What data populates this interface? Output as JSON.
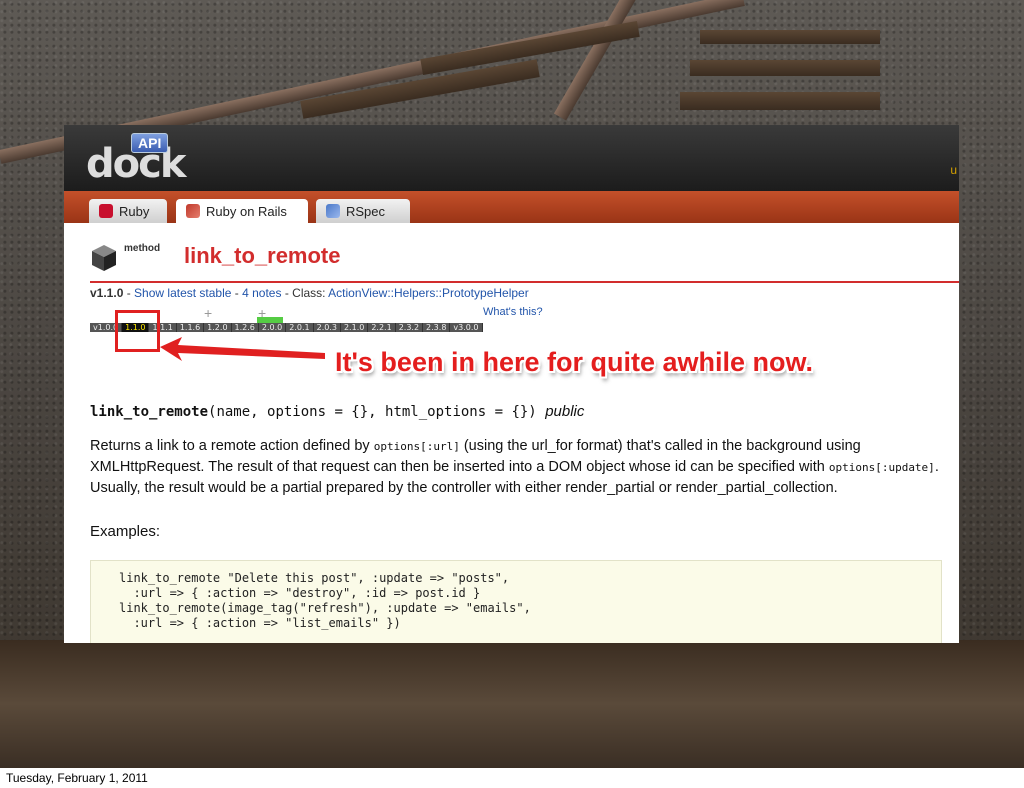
{
  "logo": {
    "api": "API",
    "name": "dock"
  },
  "header": {
    "right_glyph": "u"
  },
  "tabs": [
    {
      "label": "Ruby"
    },
    {
      "label": "Ruby on Rails"
    },
    {
      "label": "RSpec"
    }
  ],
  "method": {
    "kind": "method",
    "title": "link_to_remote",
    "version": "v1.1.0",
    "show_latest": "Show latest stable",
    "notes": "4 notes",
    "class_label": "Class:",
    "class_path": "ActionView::Helpers::PrototypeHelper",
    "whats_this": "What's this?"
  },
  "versions": [
    "v1.0.0",
    "1.1.0",
    "1.1.1",
    "1.1.6",
    "1.2.0",
    "1.2.6",
    "2.0.0",
    "2.0.1",
    "2.0.3",
    "2.1.0",
    "2.2.1",
    "2.3.2",
    "2.3.8",
    "v3.0.0"
  ],
  "version_current": "1.1.0",
  "version_plus": [
    "+",
    "+"
  ],
  "callout": "It's been in here for quite awhile now.",
  "signature": {
    "name": "link_to_remote",
    "args": "(name, options = {}, html_options = {})",
    "visibility": "public"
  },
  "description": {
    "p1": "Returns a link to a remote action defined by",
    "code1": "options[:url]",
    "p2": "(using the url_for format) that's called in the background using XMLHttpRequest. The result of that request can then be inserted into a DOM object whose id can be specified with",
    "code2": "options[:update]",
    "p3": ". Usually, the result would be a partial prepared by the controller with either render_partial or render_partial_collection."
  },
  "examples_label": "Examples:",
  "code_lines": [
    "link_to_remote \"Delete this post\", :update => \"posts\",",
    "  :url => { :action => \"destroy\", :id => post.id }",
    "link_to_remote(image_tag(\"refresh\"), :update => \"emails\",",
    "  :url => { :action => \"list_emails\" })"
  ],
  "footer": {
    "date": "Tuesday, February 1, 2011"
  }
}
